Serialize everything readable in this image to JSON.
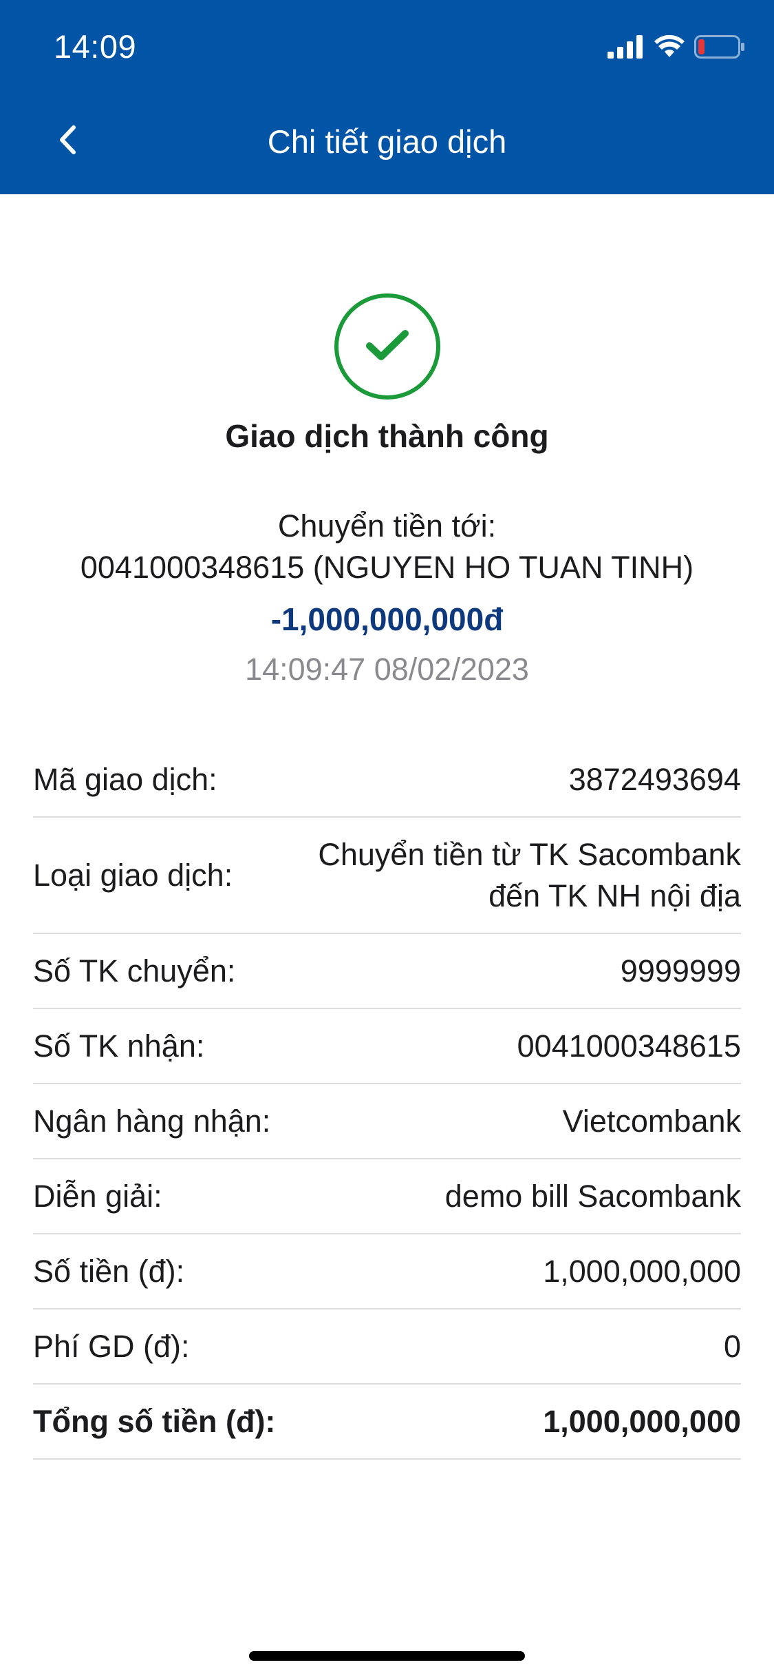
{
  "status_bar": {
    "time": "14:09"
  },
  "header": {
    "title": "Chi tiết giao dịch",
    "back_icon": "chevron-left-icon",
    "background": "#0255a6"
  },
  "result": {
    "icon": "check-circle-icon",
    "success_color": "#1a9a39",
    "title": "Giao dịch thành công",
    "transfer_label": "Chuyển tiền tới:",
    "transfer_destination": "0041000348615 (NGUYEN HO TUAN TINH)",
    "amount": "-1,000,000,000đ",
    "amount_color": "#0e3a7d",
    "timestamp": "14:09:47 08/02/2023"
  },
  "details": {
    "rows": [
      {
        "label": "Mã giao dịch:",
        "value": "3872493694"
      },
      {
        "label": "Loại giao dịch:",
        "value_line1": "Chuyển tiền từ TK Sacombank",
        "value_line2": "đến TK NH nội địa"
      },
      {
        "label": "Số TK chuyển:",
        "value": "9999999"
      },
      {
        "label": "Số TK nhận:",
        "value": "0041000348615"
      },
      {
        "label": "Ngân hàng nhận:",
        "value": "Vietcombank"
      },
      {
        "label": "Diễn giải:",
        "value": "demo bill Sacombank"
      },
      {
        "label": "Số tiền (đ):",
        "value": "1,000,000,000"
      },
      {
        "label": "Phí GD (đ):",
        "value": "0"
      },
      {
        "label": "Tổng số tiền (đ):",
        "value": "1,000,000,000"
      }
    ]
  }
}
